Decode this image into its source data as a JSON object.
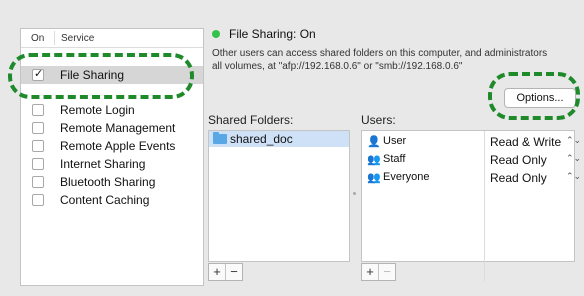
{
  "service_list": {
    "header": {
      "on_label": "On",
      "service_label": "Service"
    },
    "items": [
      {
        "label": "File Sharing",
        "checked": true,
        "selected": true
      },
      {
        "label": "Remote Login",
        "checked": false,
        "selected": false
      },
      {
        "label": "Remote Management",
        "checked": false,
        "selected": false
      },
      {
        "label": "Remote Apple Events",
        "checked": false,
        "selected": false
      },
      {
        "label": "Internet Sharing",
        "checked": false,
        "selected": false
      },
      {
        "label": "Bluetooth Sharing",
        "checked": false,
        "selected": false
      },
      {
        "label": "Content Caching",
        "checked": false,
        "selected": false
      }
    ]
  },
  "status": {
    "text": "File Sharing: On",
    "indicator_color": "#35c24a",
    "description_line1": "Other users can access shared folders on this computer, and administrators",
    "description_line2": "all volumes, at \"afp://192.168.0.6\" or \"smb://192.168.0.6\""
  },
  "options_button": {
    "label": "Options..."
  },
  "shared_folders": {
    "label": "Shared Folders:",
    "items": [
      {
        "name": "shared_doc",
        "icon": "folder-icon",
        "selected": true
      }
    ],
    "add_label": "+",
    "remove_label": "−"
  },
  "users": {
    "label": "Users:",
    "items": [
      {
        "name": "User",
        "icon": "single-user-icon",
        "permission": "Read & Write"
      },
      {
        "name": "Staff",
        "icon": "group-icon",
        "permission": "Read Only"
      },
      {
        "name": "Everyone",
        "icon": "everyone-icon",
        "permission": "Read Only"
      }
    ],
    "add_label": "+",
    "remove_label": "−"
  },
  "annotation_color": "#1f8a2a"
}
